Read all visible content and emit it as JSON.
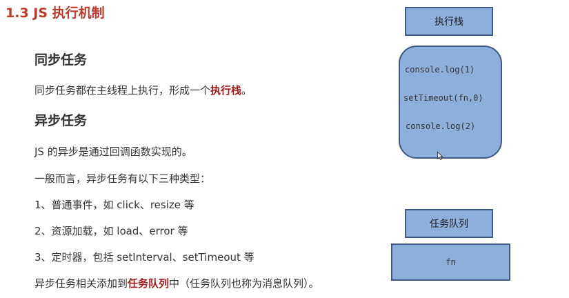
{
  "title": "1.3 JS 执行机制",
  "sync": {
    "heading": "同步任务",
    "desc_prefix": "同步任务都在主线程上执行，形成一个",
    "desc_highlight": "执行栈",
    "desc_suffix": "。"
  },
  "async": {
    "heading": "异步任务",
    "line1": "JS 的异步是通过回调函数实现的。",
    "line2": "一般而言，异步任务有以下三种类型：",
    "line3": "1、普通事件，如 click、resize 等",
    "line4": "2、资源加载，如 load、error 等",
    "line5": "3、定时器，包括 setInterval、setTimeout 等",
    "line6_prefix": "异步任务相关添加到",
    "line6_highlight": "任务队列",
    "line6_suffix": "中（任务队列也称为消息队列）。"
  },
  "diagram": {
    "stack_label": "执行栈",
    "stack_items": [
      "console.log(1)",
      "setTimeout(fn,0)",
      "console.log(2)"
    ],
    "queue_label": "任务队列",
    "queue_items": [
      "fn"
    ]
  },
  "colors": {
    "title": "#c0392b",
    "highlight": "#a61b1b",
    "box_fill": "#8eaedc",
    "box_border": "#3b5b86"
  },
  "icons": {
    "cursor": "mouse-pointer-icon"
  }
}
